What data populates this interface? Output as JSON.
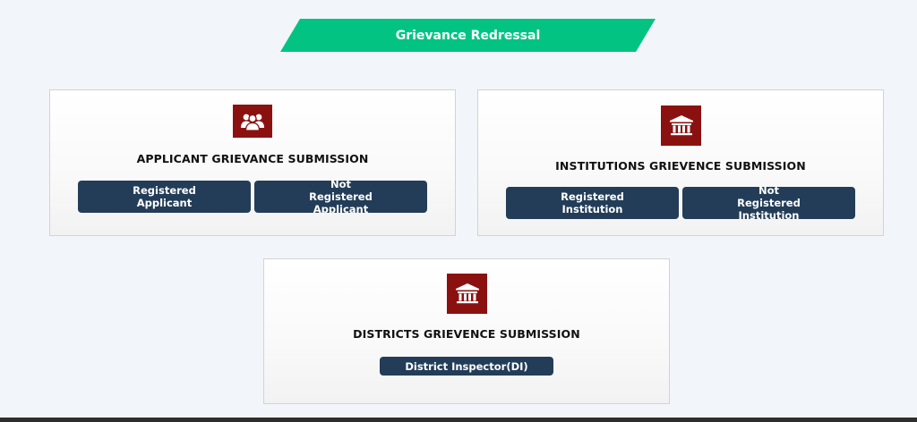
{
  "banner": {
    "title": "Grievance Redressal"
  },
  "cards": {
    "applicant": {
      "icon": "users-icon",
      "title": "APPLICANT GRIEVANCE SUBMISSION",
      "buttons": [
        "Registered Applicant",
        "Not Registered Applicant"
      ]
    },
    "institutions": {
      "icon": "institution-building-icon",
      "title": "INSTITUTIONS GRIEVENCE SUBMISSION",
      "buttons": [
        "Registered Institution",
        "Not Registered Institution"
      ]
    },
    "districts": {
      "icon": "institution-building-icon",
      "title": "DISTRICTS GRIEVENCE SUBMISSION",
      "buttons": [
        "District Inspector(DI)"
      ]
    }
  },
  "colors": {
    "banner": "#03c383",
    "button": "#233d58",
    "icon_bg": "#8b1111",
    "background": "#f2f6fa"
  }
}
